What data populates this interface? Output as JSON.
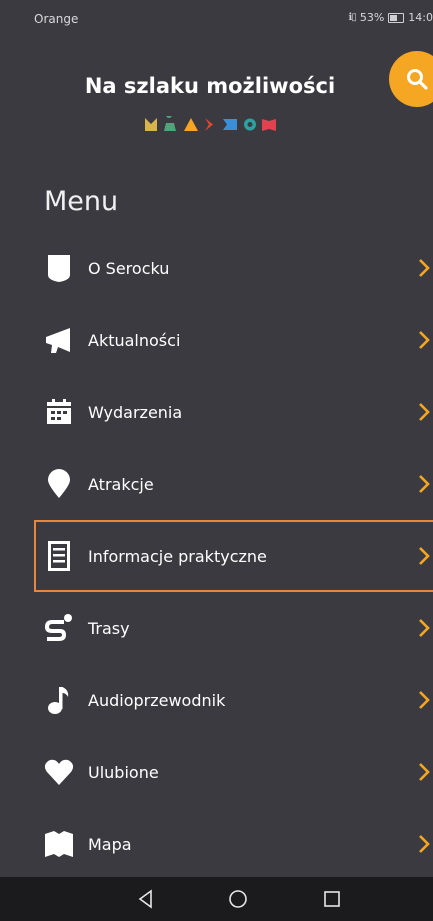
{
  "status_bar": {
    "carrier": "Orange",
    "signal_text": "ℹ▯",
    "battery_percent": "53%",
    "time": "14:0"
  },
  "header": {
    "app_title": "Na szlaku możliwości",
    "logo_colors": [
      "#d8b54c",
      "#4ca67a",
      "#f5a623",
      "#e3472a",
      "#3a8fd8",
      "#2aa3a0",
      "#e0434e"
    ],
    "search_color": "#f5a623"
  },
  "menu": {
    "title": "Menu",
    "items": [
      {
        "label": "O Serocku",
        "icon": "shield-icon"
      },
      {
        "label": "Aktualności",
        "icon": "megaphone-icon"
      },
      {
        "label": "Wydarzenia",
        "icon": "calendar-icon"
      },
      {
        "label": "Atrakcje",
        "icon": "location-pin-icon"
      },
      {
        "label": "Informacje praktyczne",
        "icon": "document-icon"
      },
      {
        "label": "Trasy",
        "icon": "route-icon"
      },
      {
        "label": "Audioprzewodnik",
        "icon": "music-note-icon"
      },
      {
        "label": "Ulubione",
        "icon": "heart-icon"
      },
      {
        "label": "Mapa",
        "icon": "map-icon"
      }
    ],
    "selected_index": 4,
    "chevron_color": "#f5a623",
    "highlight_color": "#e8873a"
  },
  "navbar": {
    "buttons": [
      "back-icon",
      "home-icon",
      "recents-icon"
    ]
  }
}
